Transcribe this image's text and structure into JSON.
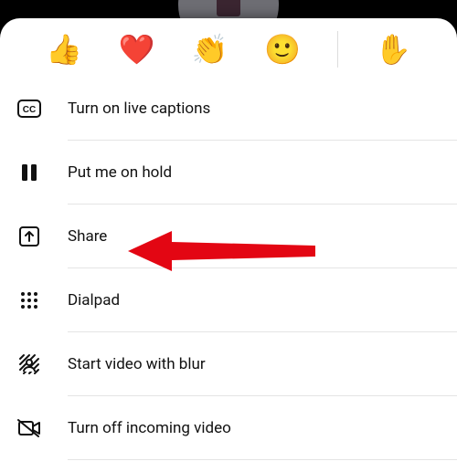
{
  "reactions": {
    "thumbs_up": "👍",
    "heart": "❤️",
    "clap": "👏",
    "smile": "🙂",
    "raise_hand": "✋"
  },
  "menu": {
    "captions": {
      "label": "Turn on live captions"
    },
    "hold": {
      "label": "Put me on hold"
    },
    "share": {
      "label": "Share"
    },
    "dialpad": {
      "label": "Dialpad"
    },
    "blur": {
      "label": "Start video with blur"
    },
    "incoming_off": {
      "label": "Turn off incoming video"
    }
  }
}
